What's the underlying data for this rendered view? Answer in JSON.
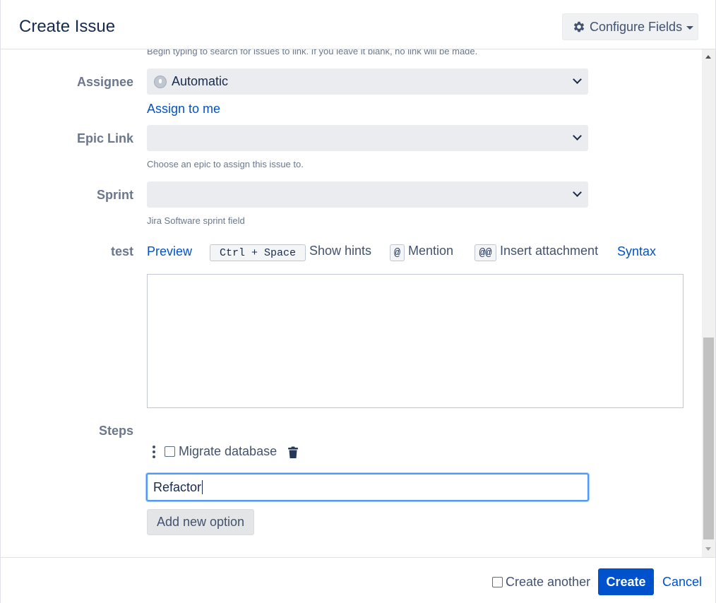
{
  "dialog": {
    "title": "Create Issue",
    "configure_fields_label": "Configure Fields"
  },
  "form": {
    "link_help_text": "Begin typing to search for issues to link. If you leave it blank, no link will be made.",
    "assignee": {
      "label": "Assignee",
      "value": "Automatic",
      "assign_to_me": "Assign to me"
    },
    "epic_link": {
      "label": "Epic Link",
      "value": "",
      "help": "Choose an epic to assign this issue to."
    },
    "sprint": {
      "label": "Sprint",
      "value": "",
      "help": "Jira Software sprint field"
    },
    "test": {
      "label": "test",
      "preview": "Preview",
      "shortcut_key": "Ctrl + Space",
      "show_hints": "Show hints",
      "mention_key": "@",
      "mention": "Mention",
      "attachment_key": "@@",
      "insert_attachment": "Insert attachment",
      "syntax": "Syntax",
      "value": ""
    },
    "steps": {
      "label": "Steps",
      "items": [
        {
          "label": "Migrate database",
          "checked": false
        }
      ],
      "new_option_value": "Refactor",
      "add_button": "Add new option"
    }
  },
  "footer": {
    "create_another": "Create another",
    "create": "Create",
    "cancel": "Cancel"
  },
  "colors": {
    "primary": "#0052cc",
    "focus_border": "#4c9aff",
    "field_bg": "#ebecf0"
  }
}
